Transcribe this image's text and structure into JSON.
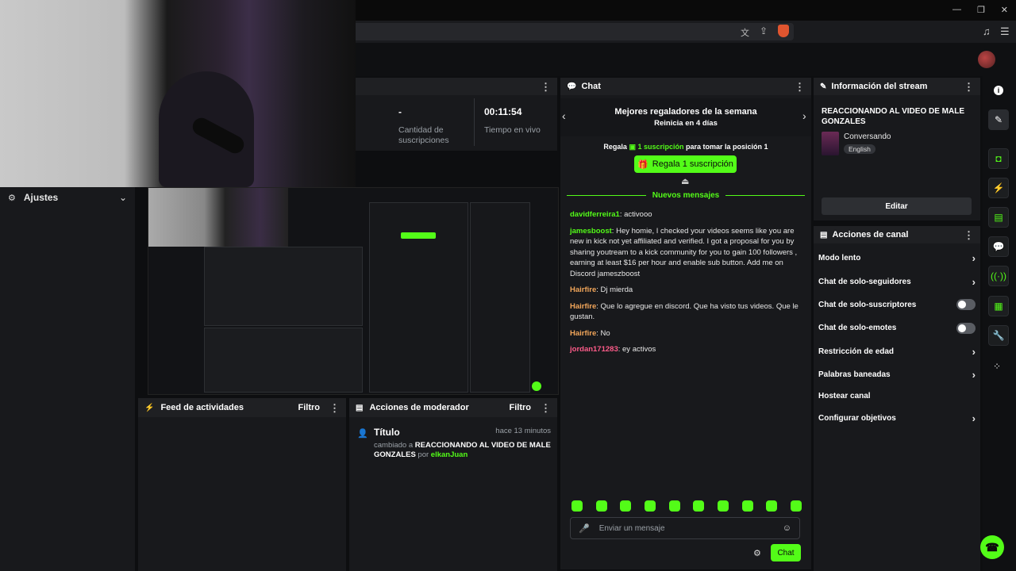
{
  "stats": {
    "subs_value": "-",
    "subs_label": "Cantidad de suscripciones",
    "live_value": "00:11:54",
    "live_label": "Tiempo en vivo"
  },
  "settings": {
    "label": "Ajustes"
  },
  "activity": {
    "title": "Feed de actividades",
    "filter": "Filtro"
  },
  "modactions": {
    "title": "Acciones de moderador",
    "filter": "Filtro",
    "item_title": "Título",
    "item_time": "hace 13 minutos",
    "item_prefix": "cambiado a",
    "item_value": "REACCIONANDO AL VIDEO DE MALE GONZALES",
    "item_by": "por",
    "item_user": "elkanJuan"
  },
  "chat": {
    "title": "Chat",
    "gifters_title": "Mejores regaladores de la semana",
    "gifters_sub": "Reinicia en 4 días",
    "gift_prefix": "Regala",
    "gift_highlight": "1 suscripción",
    "gift_suffix": "para tomar la posición 1",
    "gift_button": "Regala 1 suscripción",
    "new_messages": "Nuevos mensajes",
    "messages": [
      {
        "user": "davidferreira1",
        "color": "#53fc18",
        "text": "activooo"
      },
      {
        "user": "jamesboost",
        "color": "#53fc18",
        "text": "Hey homie, I checked your videos seems like you are new in kick not yet affiliated and verified. I got a proposal for you by sharing youtream to a kick community for you to gain 100 followers , earning at least $16 per hour and enable sub button. Add me on Discord jameszboost"
      },
      {
        "user": "Hairfire",
        "color": "#f2a65a",
        "text": "Dj mierda"
      },
      {
        "user": "Hairfire",
        "color": "#f2a65a",
        "text": "Que lo agregue en discord. Que ha visto tus videos. Que le gustan."
      },
      {
        "user": "Hairfire",
        "color": "#f2a65a",
        "text": "No"
      },
      {
        "user": "jordan171283",
        "color": "#ff5c8a",
        "text": "ey activos"
      }
    ],
    "input_placeholder": "Enviar un mensaje",
    "send_button": "Chat"
  },
  "stream_info": {
    "title": "Información del stream",
    "stream_title": "REACCIONANDO AL VIDEO DE MALE GONZALES",
    "category": "Conversando",
    "language": "English",
    "edit_button": "Editar"
  },
  "channel_actions": {
    "title": "Acciones de canal",
    "items": [
      {
        "label": "Modo lento",
        "control": "chevron"
      },
      {
        "label": "Chat de solo-seguidores",
        "control": "chevron"
      },
      {
        "label": "Chat de solo-suscriptores",
        "control": "toggle"
      },
      {
        "label": "Chat de solo-emotes",
        "control": "toggle"
      },
      {
        "label": "Restricción de edad",
        "control": "chevron"
      },
      {
        "label": "Palabras baneadas",
        "control": "chevron"
      },
      {
        "label": "Hostear canal",
        "control": "none"
      },
      {
        "label": "Configurar objetivos",
        "control": "chevron"
      }
    ]
  },
  "icons": {
    "info": "info-icon",
    "pencil": "pencil-icon",
    "translate": "translate-icon",
    "share": "share-icon",
    "brave": "brave-shield-icon",
    "music": "music-icon",
    "menu": "menu-icon"
  },
  "colors": {
    "accent": "#53fc18",
    "panel": "#18191c",
    "background": "#0d0e10"
  }
}
